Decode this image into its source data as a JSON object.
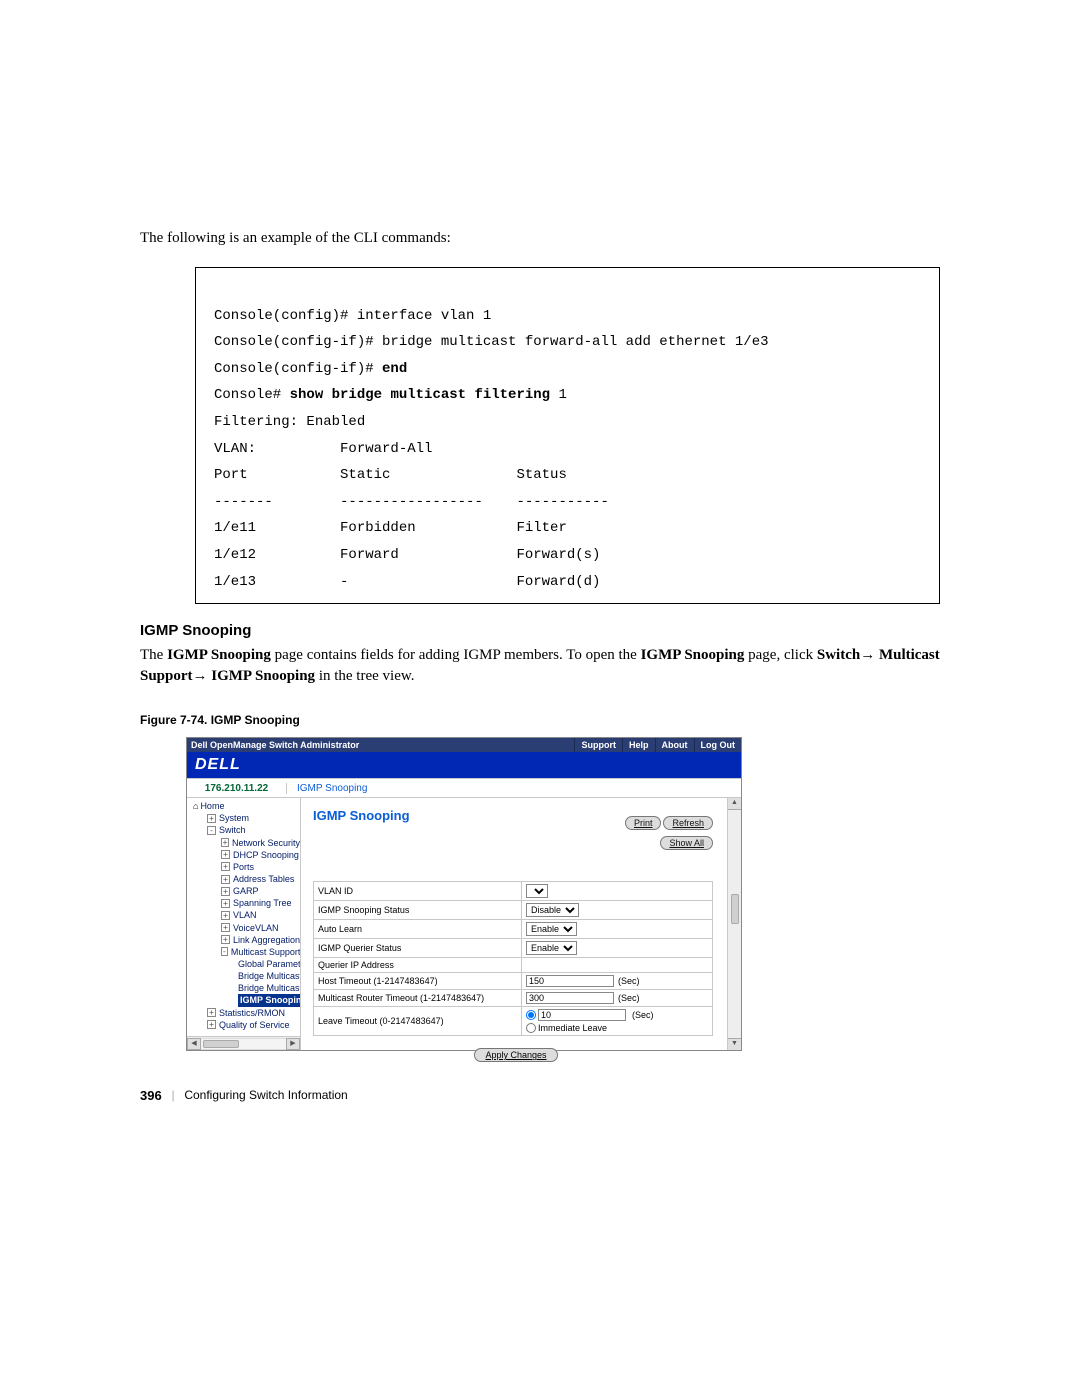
{
  "intro": "The following is an example of the CLI commands:",
  "cli": {
    "l1": "Console(config)# interface vlan 1",
    "l2": "Console(config-if)# bridge multicast forward-all add ethernet 1/e3",
    "l3a": "Console(config-if)# ",
    "l3b": "end",
    "l4a": "Console# ",
    "l4b": "show bridge multicast filtering",
    "l4c": " 1",
    "l5": "Filtering: Enabled",
    "l6": "VLAN:          Forward-All",
    "l7": "Port           Static               Status",
    "l8": "-------        -----------------    -----------",
    "l9": "1/e11          Forbidden            Filter",
    "l10": "1/e12          Forward              Forward(s)",
    "l11": "1/e13          -                    Forward(d)"
  },
  "section_heading": "IGMP Snooping",
  "body": {
    "p1a": "The ",
    "p1b": "IGMP Snooping",
    "p1c": " page contains fields for adding IGMP members. To open the ",
    "p1d": "IGMP Snooping",
    "p1e": " page, click ",
    "p1f": "Switch→ Multicast Support→ IGMP Snooping",
    "p1g": " in the tree view."
  },
  "figure_caption": "Figure 7-74.    IGMP Snooping",
  "screenshot": {
    "titlebar": {
      "title": "Dell OpenManage Switch Administrator",
      "buttons": [
        "Support",
        "Help",
        "About",
        "Log Out"
      ]
    },
    "logo": "DELL",
    "breadcrumb": {
      "ip": "176.210.11.22",
      "crumb": "IGMP Snooping"
    },
    "tree": [
      {
        "ind": 1,
        "exp": "",
        "home": true,
        "label": "Home"
      },
      {
        "ind": 2,
        "exp": "+",
        "label": "System"
      },
      {
        "ind": 2,
        "exp": "-",
        "label": "Switch"
      },
      {
        "ind": 3,
        "exp": "+",
        "label": "Network Security"
      },
      {
        "ind": 3,
        "exp": "+",
        "label": "DHCP Snooping"
      },
      {
        "ind": 3,
        "exp": "+",
        "label": "Ports"
      },
      {
        "ind": 3,
        "exp": "+",
        "label": "Address Tables"
      },
      {
        "ind": 3,
        "exp": "+",
        "label": "GARP"
      },
      {
        "ind": 3,
        "exp": "+",
        "label": "Spanning Tree"
      },
      {
        "ind": 3,
        "exp": "+",
        "label": "VLAN"
      },
      {
        "ind": 3,
        "exp": "+",
        "label": "VoiceVLAN"
      },
      {
        "ind": 3,
        "exp": "+",
        "label": "Link Aggregation"
      },
      {
        "ind": 3,
        "exp": "-",
        "label": "Multicast Support"
      },
      {
        "ind": 4,
        "exp": "",
        "label": "Global Parameter"
      },
      {
        "ind": 4,
        "exp": "",
        "label": "Bridge Multicast ("
      },
      {
        "ind": 4,
        "exp": "",
        "label": "Bridge Multicast F"
      },
      {
        "ind": 4,
        "exp": "",
        "label": "IGMP Snooping",
        "current": true
      },
      {
        "ind": 2,
        "exp": "+",
        "label": "Statistics/RMON"
      },
      {
        "ind": 2,
        "exp": "+",
        "label": "Quality of Service"
      }
    ],
    "content": {
      "title": "IGMP Snooping",
      "actions": {
        "print": "Print",
        "refresh": "Refresh",
        "showall": "Show All"
      },
      "fields": {
        "vlan_id": "VLAN ID",
        "snoop_status": "IGMP Snooping Status",
        "auto_learn": "Auto Learn",
        "querier_status": "IGMP Querier Status",
        "querier_ip": "Querier IP Address",
        "host_timeout": "Host Timeout (1-2147483647)",
        "mrouter_timeout": "Multicast Router Timeout (1-2147483647)",
        "leave_timeout": "Leave Timeout (0-2147483647)"
      },
      "values": {
        "snoop_status": "Disable",
        "auto_learn": "Enable",
        "querier_status": "Enable",
        "host_timeout": "150",
        "mrouter_timeout": "300",
        "leave_timeout_val": "10",
        "immediate_leave": "Immediate Leave",
        "sec": "(Sec)"
      },
      "apply": "Apply Changes"
    }
  },
  "footer": {
    "page": "396",
    "chapter": "Configuring Switch Information"
  }
}
